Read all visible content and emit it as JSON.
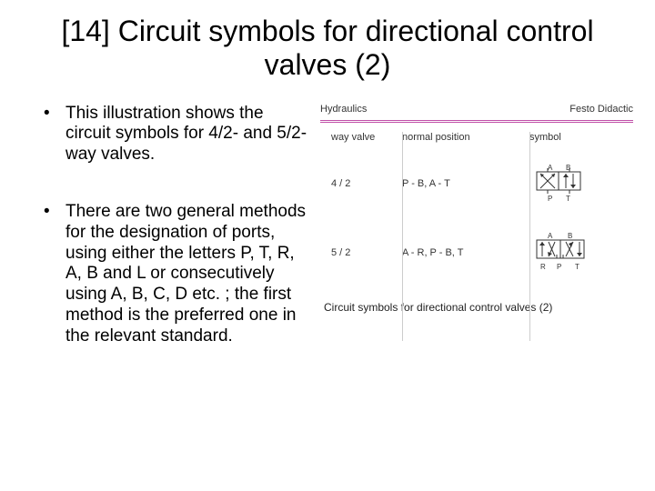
{
  "title": "[14] Circuit symbols for directional control valves (2)",
  "bullets": [
    "This illustration shows the circuit symbols for 4/2- and 5/2-way valves.",
    "There are two general methods for the designation of ports, using either the letters P, T, R, A, B and L or consecutively using A, B, C, D etc. ; the first method is the preferred one in the relevant standard."
  ],
  "diagram": {
    "header_left": "Hydraulics",
    "header_right": "Festo Didactic",
    "columns": [
      "way valve",
      "normal position",
      "symbol"
    ],
    "rows": [
      {
        "way": "4 / 2",
        "normal": "P - B,  A - T",
        "ports_top": "A  B",
        "ports_bottom": "P  T"
      },
      {
        "way": "5 / 2",
        "normal": "A - R,  P - B, T",
        "ports_top": "A  B",
        "ports_bottom": "R  P  T"
      }
    ],
    "caption": "Circuit symbols for directional control valves (2)"
  }
}
